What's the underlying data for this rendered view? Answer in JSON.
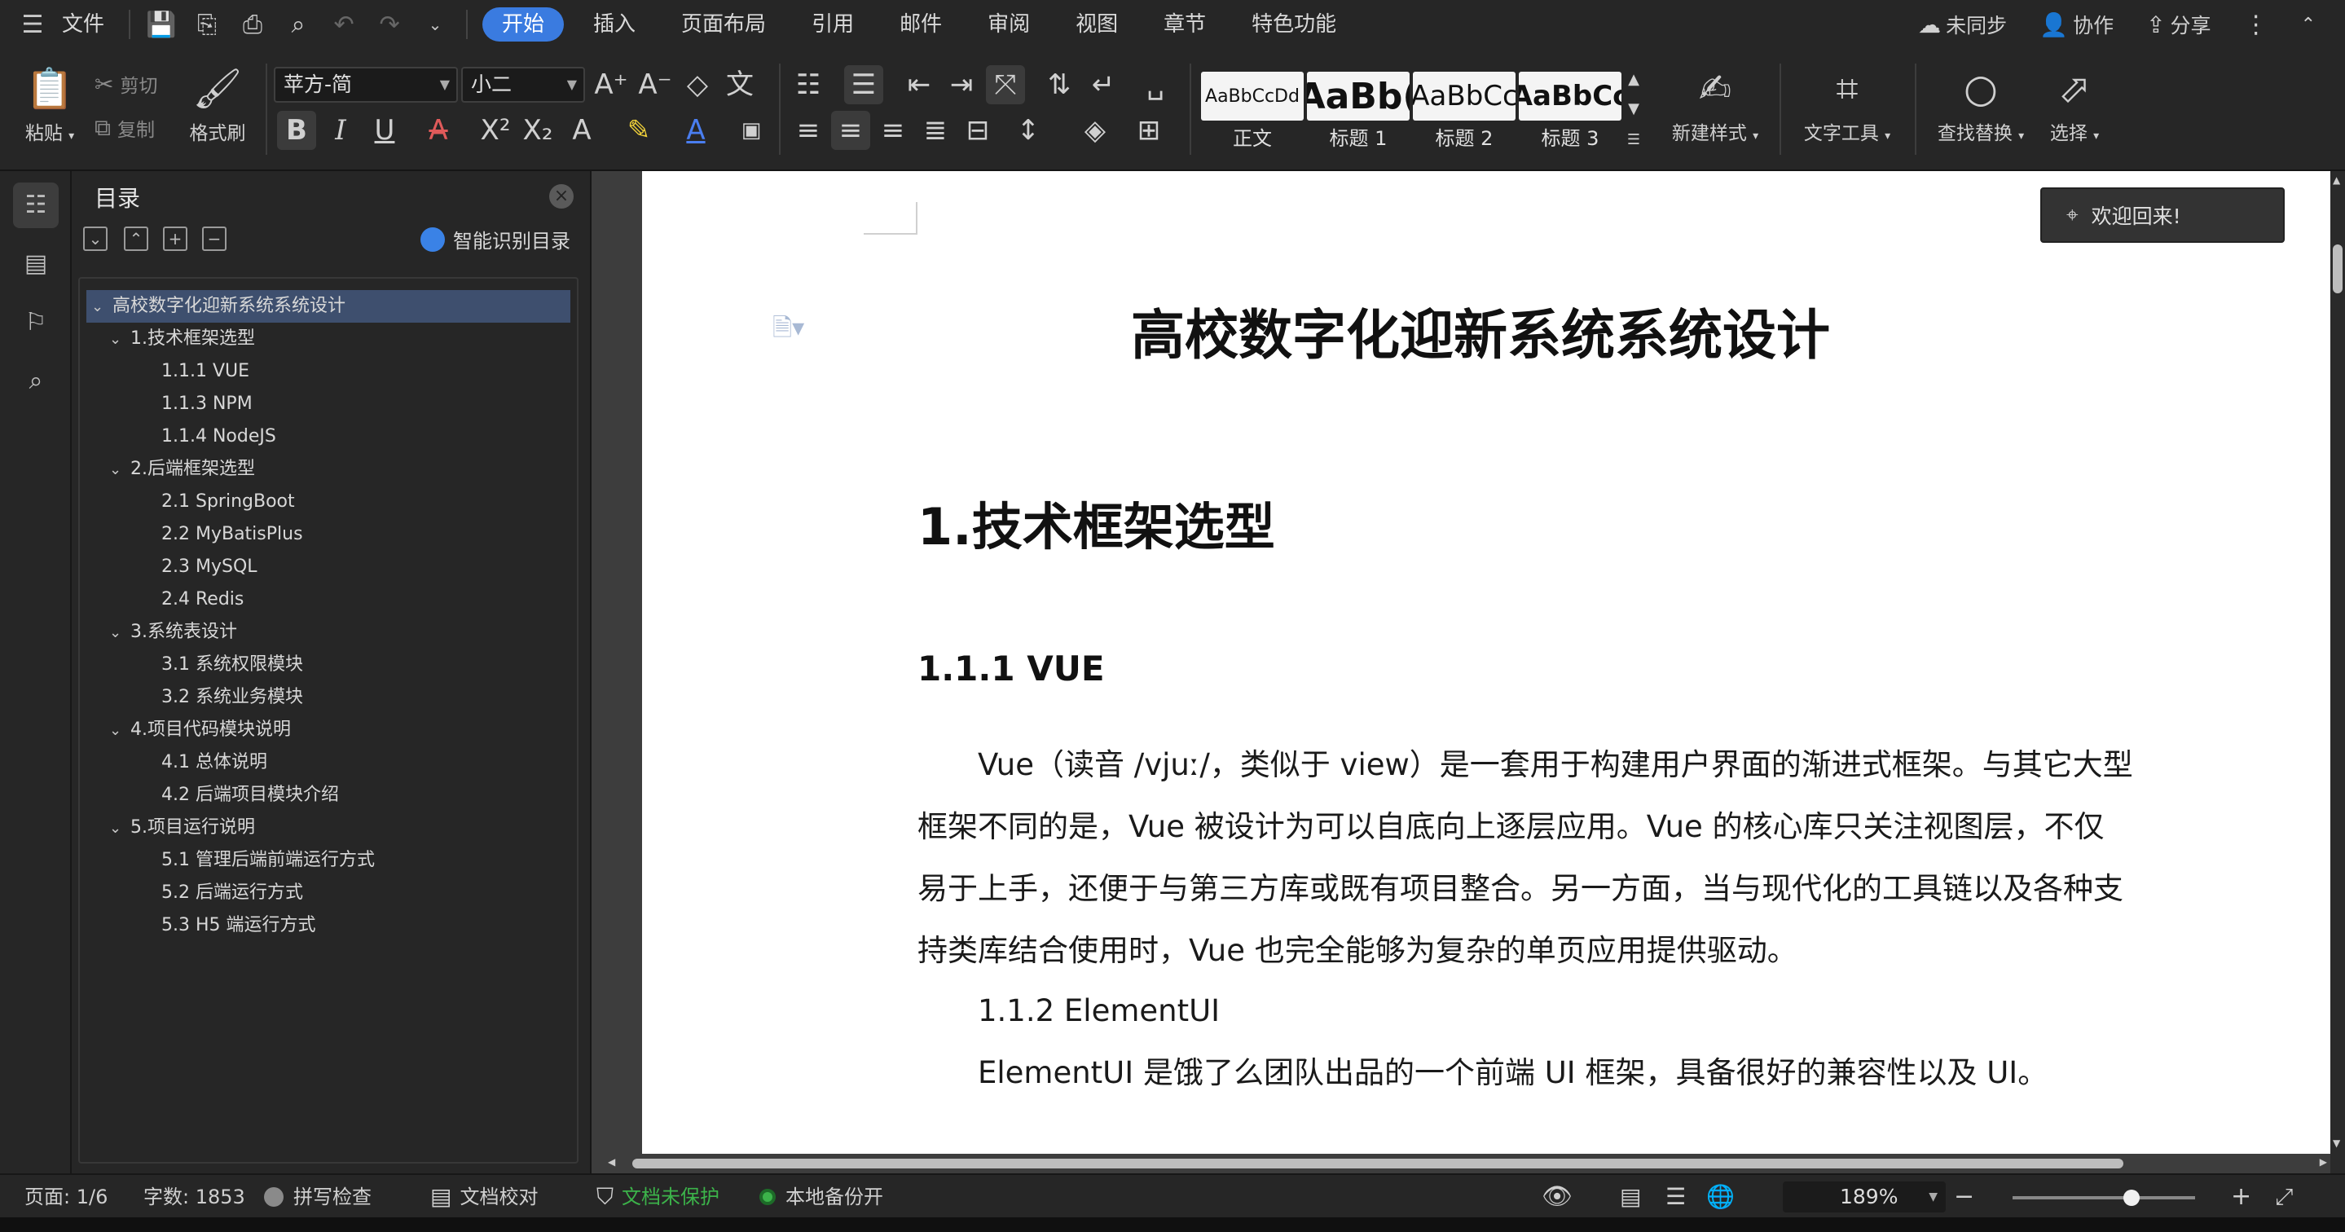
{
  "menubar": {
    "file_label": "文件",
    "tabs": [
      "开始",
      "插入",
      "页面布局",
      "引用",
      "邮件",
      "审阅",
      "视图",
      "章节",
      "特色功能"
    ],
    "active_tab": "开始",
    "right": {
      "sync_label": "未同步",
      "collab_label": "协作",
      "share_label": "分享"
    }
  },
  "ribbon": {
    "paste_label": "粘贴",
    "cut_label": "剪切",
    "copy_label": "复制",
    "format_painter_label": "格式刷",
    "font_name": "苹方-简",
    "font_size": "小二",
    "styles": [
      {
        "preview": "AaBbCcDd",
        "label": "正文"
      },
      {
        "preview": "AaBb(",
        "label": "标题 1"
      },
      {
        "preview": "AaBbCc",
        "label": "标题 2"
      },
      {
        "preview": "AaBbCc",
        "label": "标题 3"
      }
    ],
    "new_style_label": "新建样式",
    "text_tools_label": "文字工具",
    "find_replace_label": "查找替换",
    "select_label": "选择"
  },
  "toc": {
    "title": "目录",
    "smart_label": "智能识别目录",
    "items": [
      {
        "text": "高校数字化迎新系统系统设计",
        "level": 0,
        "expanded": true,
        "selected": true
      },
      {
        "text": "1.技术框架选型",
        "level": 1,
        "expanded": true
      },
      {
        "text": "1.1.1 VUE",
        "level": 2
      },
      {
        "text": "1.1.3 NPM",
        "level": 2
      },
      {
        "text": "1.1.4 NodeJS",
        "level": 2
      },
      {
        "text": "2.后端框架选型",
        "level": 1,
        "expanded": true
      },
      {
        "text": "2.1 SpringBoot",
        "level": 2
      },
      {
        "text": "2.2 MyBatisPlus",
        "level": 2
      },
      {
        "text": "2.3 MySQL",
        "level": 2
      },
      {
        "text": "2.4 Redis",
        "level": 2
      },
      {
        "text": "3.系统表设计",
        "level": 1,
        "expanded": true
      },
      {
        "text": "3.1  系统权限模块",
        "level": 2
      },
      {
        "text": "3.2  系统业务模块",
        "level": 2
      },
      {
        "text": "4.项目代码模块说明",
        "level": 1,
        "expanded": true
      },
      {
        "text": "4.1  总体说明",
        "level": 2
      },
      {
        "text": "4.2  后端项目模块介绍",
        "level": 2
      },
      {
        "text": "5.项目运行说明",
        "level": 1,
        "expanded": true
      },
      {
        "text": "5.1  管理后端前端运行方式",
        "level": 2
      },
      {
        "text": "5.2  后端运行方式",
        "level": 2
      },
      {
        "text": "5.3 H5 端运行方式",
        "level": 2
      }
    ]
  },
  "document": {
    "title": "高校数字化迎新系统系统设计",
    "heading1": "1.技术框架选型",
    "heading2": "1.1.1 VUE",
    "paragraph_lines": [
      "　　Vue（读音  /vjuː/，类似于  view）是一套用于构建用户界面的渐进式框架。与其它大型",
      "框架不同的是，Vue  被设计为可以自底向上逐层应用。Vue  的核心库只关注视图层，不仅",
      "易于上手，还便于与第三方库或既有项目整合。另一方面，当与现代化的工具链以及各种支",
      "持类库结合使用时，Vue  也完全能够为复杂的单页应用提供驱动。"
    ],
    "line_element_ui": "　　1.1.2 ElementUI",
    "line_element_desc": "　　ElementUI 是饿了么团队出品的一个前端 UI 框架，具备很好的兼容性以及 UI。",
    "toast": "欢迎回来!"
  },
  "status": {
    "page": "页面: 1/6",
    "words": "字数: 1853",
    "spell": "拼写检查",
    "proof": "文档校对",
    "protect": "文档未保护",
    "backup": "本地备份开",
    "zoom": "189%",
    "zoom_level": 0.34
  },
  "colors": {
    "accent": "#3a7be0",
    "protect_green": "#3cb34a",
    "backup_green": "#3cb34a"
  }
}
